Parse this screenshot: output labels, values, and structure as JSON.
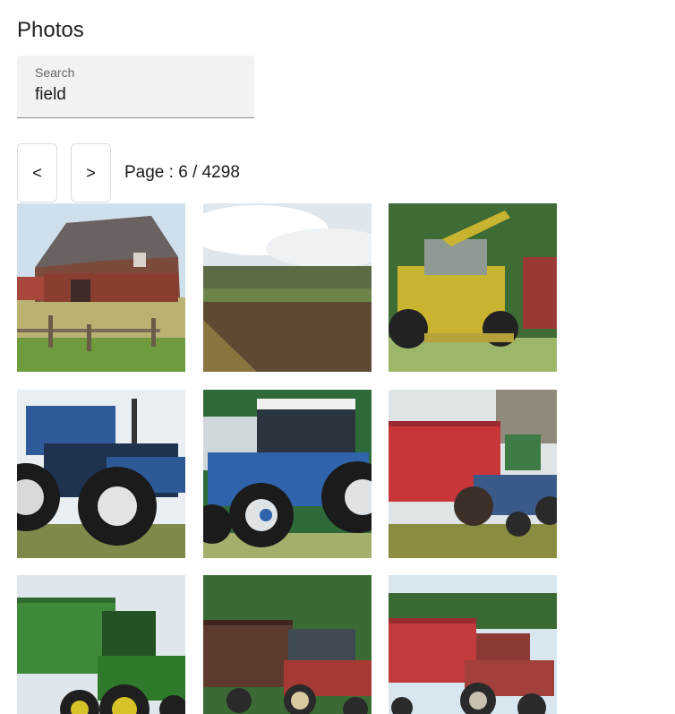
{
  "header": {
    "title": "Photos"
  },
  "search": {
    "label": "Search",
    "value": "field"
  },
  "pagination": {
    "prev_label": "<",
    "next_label": ">",
    "page_text": "Page : 6 / 4298"
  },
  "photos": [
    {
      "icon": "barn-photo"
    },
    {
      "icon": "field-landscape-photo"
    },
    {
      "icon": "yellow-harvester-photo"
    },
    {
      "icon": "blue-tractor-photo"
    },
    {
      "icon": "blue-ford-tractor-photo"
    },
    {
      "icon": "red-trailer-blue-tractor-photo"
    },
    {
      "icon": "green-tractor-trailer-photo"
    },
    {
      "icon": "red-tractor-trailer-photo"
    },
    {
      "icon": "red-trailer-red-tractor-photo"
    }
  ]
}
